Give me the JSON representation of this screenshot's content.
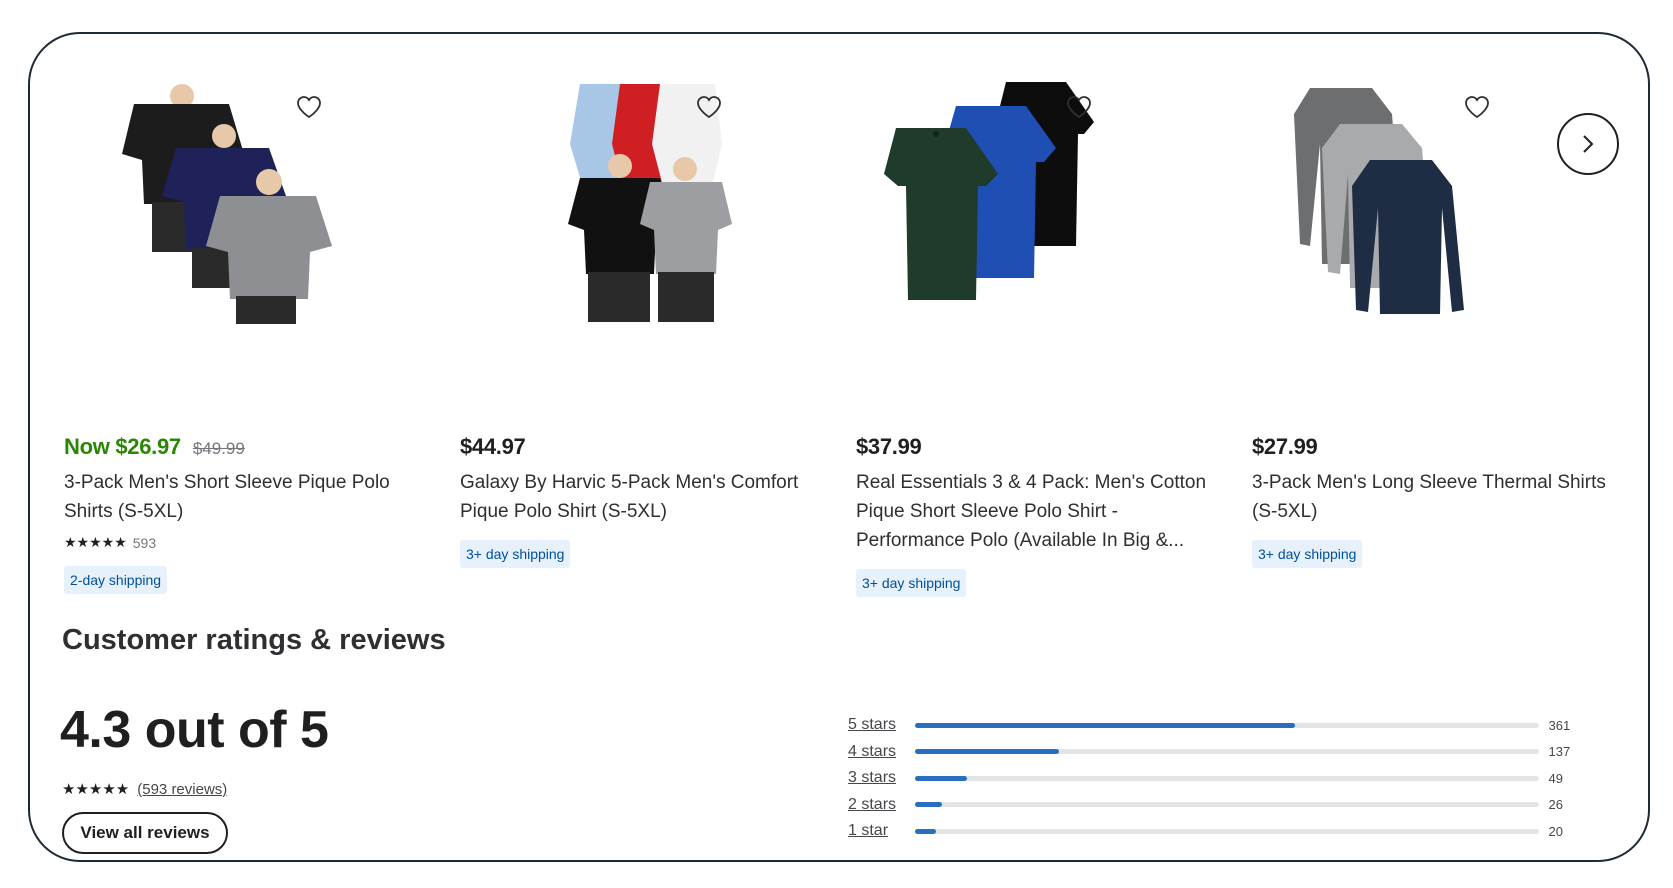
{
  "products": [
    {
      "price": "Now $26.97",
      "was_price": "$49.99",
      "title": "3-Pack Men's Short Sleeve Pique Polo Shirts (S-5XL)",
      "stars": "★★★★★",
      "rating_count": "593",
      "shipping": "2-day shipping",
      "image": "three-polo-shirts-black-navy-gray"
    },
    {
      "price": "$44.97",
      "title": "Galaxy By Harvic 5-Pack Men's Comfort Pique Polo Shirt (S-5XL)",
      "shipping": "3+ day shipping",
      "image": "five-polo-shirts-multicolor"
    },
    {
      "price": "$37.99",
      "title": "Real Essentials 3 & 4 Pack: Men's Cotton Pique Short Sleeve Polo Shirt - Performance Polo (Available In Big &...",
      "shipping": "3+ day shipping",
      "image": "three-polo-shirts-green-blue-black"
    },
    {
      "price": "$27.99",
      "title": "3-Pack Men's Long Sleeve Thermal Shirts (S-5XL)",
      "shipping": "3+ day shipping",
      "image": "three-thermal-shirts-gray-navy"
    }
  ],
  "icons": {
    "favorite": "heart-icon",
    "next": "chevron-right-icon"
  },
  "reviews": {
    "title": "Customer ratings & reviews",
    "average_text": "4.3 out of 5",
    "stars": "★★★★★",
    "review_count_text": "(593 reviews)",
    "view_all_label": "View all reviews",
    "distribution": [
      {
        "label": "5 stars",
        "count": "361",
        "value": 361
      },
      {
        "label": "4 stars",
        "count": "137",
        "value": 137
      },
      {
        "label": "3 stars",
        "count": "49",
        "value": 49
      },
      {
        "label": "2 stars",
        "count": "26",
        "value": 26
      },
      {
        "label": "1 star",
        "count": "20",
        "value": 20
      }
    ],
    "bar_max": 593
  },
  "colors": {
    "sale_price": "#2a8703",
    "shipping_badge_bg": "#e6f1fc",
    "shipping_badge_text": "#004f9a",
    "bar_fill": "#2a6fbf",
    "bar_track": "#e3e4e5"
  }
}
